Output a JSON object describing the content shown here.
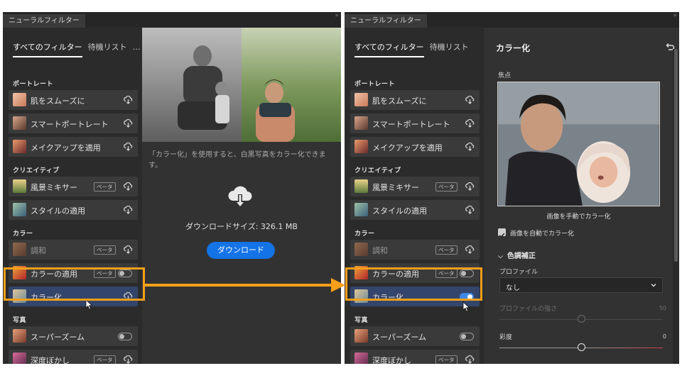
{
  "panel_title": "ニューラルフィルター",
  "tabs": {
    "all_filters": "すべてのフィルター",
    "wait_list": "待機リスト",
    "more": "…"
  },
  "sections": {
    "portrait": "ポートレート",
    "creative": "クリエイティブ",
    "color": "カラー",
    "photo": "写真"
  },
  "filters": {
    "smooth_skin": "肌をスムーズに",
    "smart_portrait": "スマートポートレート",
    "makeup": "メイクアップを適用",
    "landscape": "風景ミキサー",
    "style": "スタイルの適用",
    "harmonize": "調和",
    "color_transfer": "カラーの適用",
    "colorize": "カラー化",
    "super_zoom": "スーパーズーム",
    "depth_blur": "深度ぼかし"
  },
  "beta_badge": "ベータ",
  "download": {
    "description": "「カラー化」を使用すると、白黒写真をカラー化できます。",
    "size_text": "ダウンロードサイズ: 326.1 MB",
    "button": "ダウンロード"
  },
  "settings": {
    "title": "カラー化",
    "focus_label": "焦点",
    "manual_caption": "画像を手動でカラー化",
    "auto_checkbox": "画像を自動でカラー化",
    "auto_checked": true,
    "color_adjust": "色調補正",
    "profile_label": "プロファイル",
    "profile_value": "なし",
    "profile_strength_label": "プロファイルの強さ",
    "profile_strength_value": "50",
    "saturation_label": "彩度",
    "saturation_value": "0"
  },
  "colors": {
    "highlight": "#f79f1a",
    "accent_blue": "#1473e6",
    "panel_bg": "#323232",
    "sidebar_bg": "#2b2b2b"
  },
  "icons": [
    "cloud-download-icon",
    "cursor-icon",
    "reset-icon",
    "chevron-down-icon",
    "checkmark-icon",
    "arrow-right-icon"
  ]
}
